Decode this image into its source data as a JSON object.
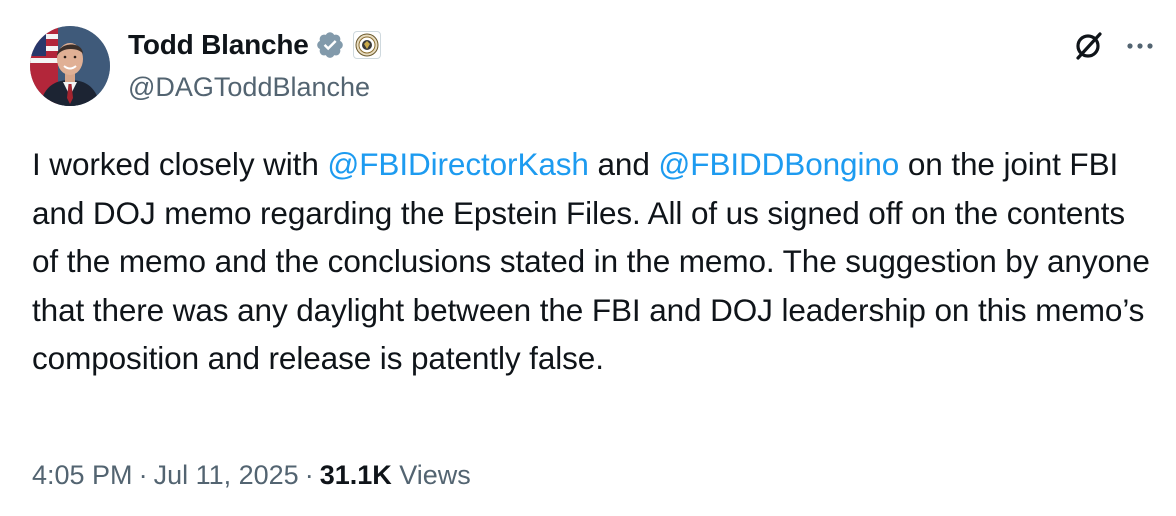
{
  "author": {
    "display_name": "Todd Blanche",
    "handle": "@DAGToddBlanche",
    "verified": true,
    "badge_icon": "doj-seal-icon"
  },
  "tweet": {
    "text_before_first_mention": "I worked closely with ",
    "mention_1": "@FBIDirectorKash",
    "text_between_mentions": " and ",
    "mention_2": "@FBIDDBongino",
    "text_after_mentions": " on the joint FBI and DOJ memo regarding the Epstein Files. All of us signed off on the contents of the memo and the conclusions stated in the memo. The suggestion by anyone that there was any daylight between the FBI and DOJ leadership on this memo’s composition and release is patently false."
  },
  "meta": {
    "time": "4:05 PM",
    "date": "Jul 11, 2025",
    "separator": "·",
    "views_count": "31.1K",
    "views_label": "Views"
  },
  "icons": {
    "verified": "verified-badge-icon",
    "grok": "grok-icon",
    "more": "more-options-icon"
  },
  "colors": {
    "mention": "#1d9bf0",
    "verified": "#829aab",
    "secondary_text": "#536471",
    "primary_text": "#0f1419"
  }
}
